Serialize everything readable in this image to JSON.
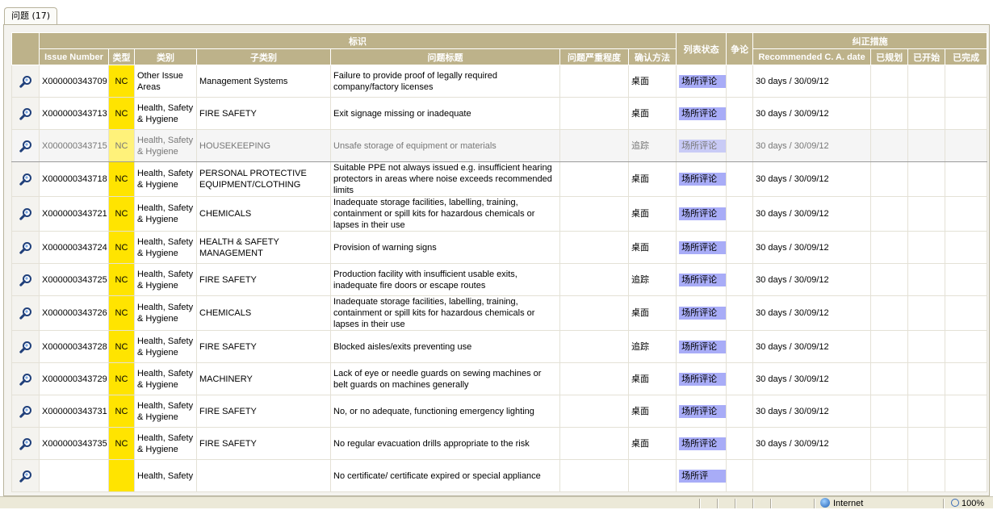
{
  "tab": {
    "label": "问题 (17)"
  },
  "header": {
    "group_identity": "标识",
    "group_status": "列表状态",
    "group_dispute": "争论",
    "group_corrective": "纠正措施",
    "col_issue_number": "Issue Number",
    "col_type": "类型",
    "col_category": "类别",
    "col_subcategory": "子类别",
    "col_title": "问题标题",
    "col_severity": "问题严重程度",
    "col_method": "确认方法",
    "col_recommended": "Recommended C. A. date",
    "col_planned": "已规划",
    "col_started": "已开始",
    "col_completed": "已完成"
  },
  "rows": [
    {
      "num": "X000000343709",
      "type": "NC",
      "category": "Other Issue Areas",
      "subcategory": "Management Systems",
      "title": "Failure to provide proof of legally required company/factory licenses",
      "severity": "",
      "method": "桌面",
      "status": "场所评论",
      "recommended": "30 days / 30/09/12"
    },
    {
      "num": "X000000343713",
      "type": "NC",
      "category": "Health, Safety & Hygiene",
      "subcategory": "FIRE SAFETY",
      "title": "Exit signage missing or inadequate",
      "severity": "",
      "method": "桌面",
      "status": "场所评论",
      "recommended": "30 days / 30/09/12"
    },
    {
      "num": "X000000343715",
      "type": "NC",
      "category": "Health, Safety & Hygiene",
      "subcategory": "HOUSEKEEPING",
      "title": "Unsafe storage of equipment or materials",
      "severity": "",
      "method": "追踪",
      "status": "场所评论",
      "recommended": "30 days / 30/09/12",
      "selected": true
    },
    {
      "num": "X000000343718",
      "type": "NC",
      "category": "Health, Safety & Hygiene",
      "subcategory": "PERSONAL PROTECTIVE EQUIPMENT/CLOTHING",
      "title": "Suitable PPE not always issued e.g. insufficient hearing protectors in areas where noise exceeds recommended limits",
      "severity": "",
      "method": "桌面",
      "status": "场所评论",
      "recommended": "30 days / 30/09/12"
    },
    {
      "num": "X000000343721",
      "type": "NC",
      "category": "Health, Safety & Hygiene",
      "subcategory": "CHEMICALS",
      "title": "Inadequate storage facilities, labelling, training, containment or spill kits for hazardous chemicals or lapses in their use",
      "severity": "",
      "method": "桌面",
      "status": "场所评论",
      "recommended": "30 days / 30/09/12"
    },
    {
      "num": "X000000343724",
      "type": "NC",
      "category": "Health, Safety & Hygiene",
      "subcategory": "HEALTH & SAFETY MANAGEMENT",
      "title": "Provision of warning signs",
      "severity": "",
      "method": "桌面",
      "status": "场所评论",
      "recommended": "30 days / 30/09/12"
    },
    {
      "num": "X000000343725",
      "type": "NC",
      "category": "Health, Safety & Hygiene",
      "subcategory": "FIRE SAFETY",
      "title": "Production facility with insufficient usable exits, inadequate fire doors or escape routes",
      "severity": "",
      "method": "追踪",
      "status": "场所评论",
      "recommended": "30 days / 30/09/12"
    },
    {
      "num": "X000000343726",
      "type": "NC",
      "category": "Health, Safety & Hygiene",
      "subcategory": "CHEMICALS",
      "title": "Inadequate storage facilities, labelling, training, containment or spill kits for hazardous chemicals or lapses in their use",
      "severity": "",
      "method": "桌面",
      "status": "场所评论",
      "recommended": "30 days / 30/09/12"
    },
    {
      "num": "X000000343728",
      "type": "NC",
      "category": "Health, Safety & Hygiene",
      "subcategory": "FIRE SAFETY",
      "title": "Blocked aisles/exits preventing use",
      "severity": "",
      "method": "追踪",
      "status": "场所评论",
      "recommended": "30 days / 30/09/12"
    },
    {
      "num": "X000000343729",
      "type": "NC",
      "category": "Health, Safety & Hygiene",
      "subcategory": "MACHINERY",
      "title": "Lack of eye or needle guards on sewing machines or belt guards on machines generally",
      "severity": "",
      "method": "桌面",
      "status": "场所评论",
      "recommended": "30 days / 30/09/12"
    },
    {
      "num": "X000000343731",
      "type": "NC",
      "category": "Health, Safety & Hygiene",
      "subcategory": "FIRE SAFETY",
      "title": "No, or no adequate, functioning emergency lighting",
      "severity": "",
      "method": "桌面",
      "status": "场所评论",
      "recommended": "30 days / 30/09/12"
    },
    {
      "num": "X000000343735",
      "type": "NC",
      "category": "Health, Safety & Hygiene",
      "subcategory": "FIRE SAFETY",
      "title": "No regular evacuation drills appropriate to the risk",
      "severity": "",
      "method": "桌面",
      "status": "场所评论",
      "recommended": "30 days / 30/09/12"
    },
    {
      "num": "",
      "type": "",
      "category": "Health, Safety",
      "subcategory": "",
      "title": "No certificate/ certificate expired or special appliance",
      "severity": "",
      "method": "",
      "status": "场所评",
      "recommended": ""
    }
  ],
  "statusbar": {
    "zone": "Internet",
    "zoom": "100%"
  },
  "colors": {
    "header": "#bdb28a",
    "type_nc": "#ffe400",
    "status": "#a8acf7"
  },
  "icons": {
    "row_action": "magnifier-icon",
    "zone": "globe-icon",
    "zoom": "zoom-icon"
  }
}
